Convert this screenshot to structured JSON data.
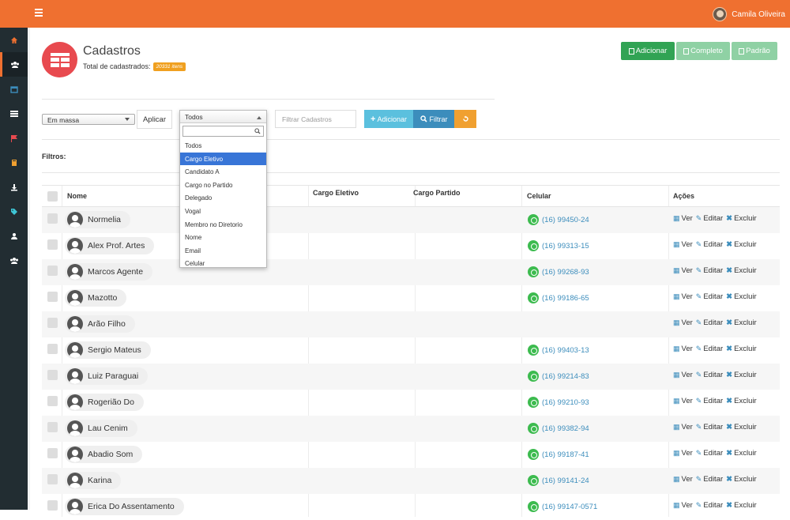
{
  "header": {
    "user_name": "Camila Oliveira"
  },
  "sidebar": {
    "items": [
      "home-icon",
      "users-icon",
      "calendar-icon",
      "list-icon",
      "flag-icon",
      "book-icon",
      "download-icon",
      "tag-icon",
      "user-icon",
      "group-icon"
    ]
  },
  "page": {
    "title": "Cadastros",
    "total_label": "Total de cadastrados:",
    "total_badge": "20331 itens"
  },
  "top_buttons": {
    "add": "Adicionar",
    "full": "Completo",
    "default": "Padrão"
  },
  "toolbar": {
    "bulk_select": "Em massa",
    "apply": "Aplicar",
    "filter_select": "Todos",
    "filter_placeholder": "Filtrar Cadastros",
    "add": "Adicionar",
    "filter": "Filtrar"
  },
  "dropdown": {
    "options": [
      "Todos",
      "Cargo Eletivo",
      "Candidato A",
      "Cargo no Partido",
      "Delegado",
      "Vogal",
      "Membro no Diretorio",
      "Nome",
      "Email",
      "Celular"
    ],
    "selected_index": 1
  },
  "filters_label": "Filtros:",
  "table": {
    "headers": {
      "name": "Nome",
      "elective": "Cargo Eletivo",
      "party": "Cargo Partido",
      "phone": "Celular",
      "actions": "Ações"
    },
    "action_labels": {
      "view": "Ver",
      "edit": "Editar",
      "delete": "Excluir"
    },
    "rows": [
      {
        "name": "Normelia",
        "phone": "(16) 99450-24"
      },
      {
        "name": "Alex Prof. Artes",
        "phone": "(16) 99313-15"
      },
      {
        "name": "Marcos Agente",
        "phone": "(16) 99268-93"
      },
      {
        "name": "Mazotto",
        "phone": "(16) 99186-65"
      },
      {
        "name": "Arão Filho",
        "phone": ""
      },
      {
        "name": "Sergio Mateus",
        "phone": "(16) 99403-13"
      },
      {
        "name": "Luiz Paraguai",
        "phone": "(16) 99214-83"
      },
      {
        "name": "Rogerião Do",
        "phone": "(16) 99210-93"
      },
      {
        "name": "Lau Cenim",
        "phone": "(16) 99382-94"
      },
      {
        "name": "Abadio Som",
        "phone": "(16) 99187-41"
      },
      {
        "name": "Karina",
        "phone": "(16) 99141-24"
      },
      {
        "name": "Erica Do Assentamento",
        "phone": "(16) 99147-0571"
      }
    ]
  },
  "colors": {
    "accent": "#ef7030",
    "sidebar": "#222d32",
    "success": "#31a354",
    "info": "#5bc0de",
    "primary": "#3c8dbc",
    "warning": "#f0a030"
  }
}
